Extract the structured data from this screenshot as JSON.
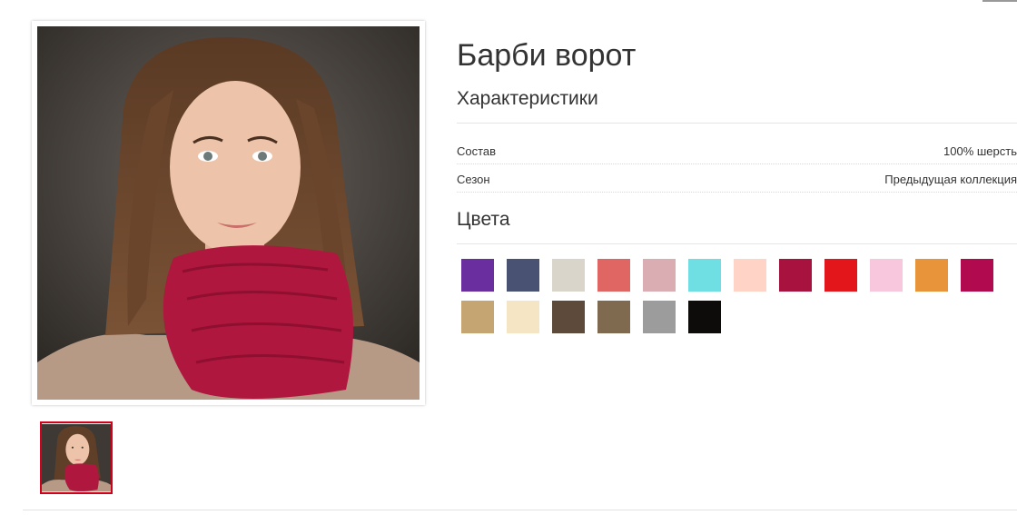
{
  "product": {
    "title": "Барби ворот",
    "characteristics_heading": "Характеристики",
    "colors_heading": "Цвета",
    "specs": [
      {
        "label": "Состав",
        "value": "100% шерсть"
      },
      {
        "label": "Сезон",
        "value": "Предыдущая коллекция"
      }
    ],
    "colors": [
      "#6a2e9e",
      "#4a5274",
      "#d9d5cb",
      "#e06664",
      "#d9adb2",
      "#70dfe3",
      "#ffd3c6",
      "#a8123f",
      "#e3161b",
      "#f8c6dd",
      "#e8943a",
      "#b20a4f",
      "#c5a571",
      "#f5e5c4",
      "#5e4a3a",
      "#7f6a50",
      "#9c9c9c",
      "#0e0c0b"
    ]
  },
  "gallery": {
    "main_image_icon": "product-photo",
    "thumbnail_icon": "product-thumbnail"
  }
}
